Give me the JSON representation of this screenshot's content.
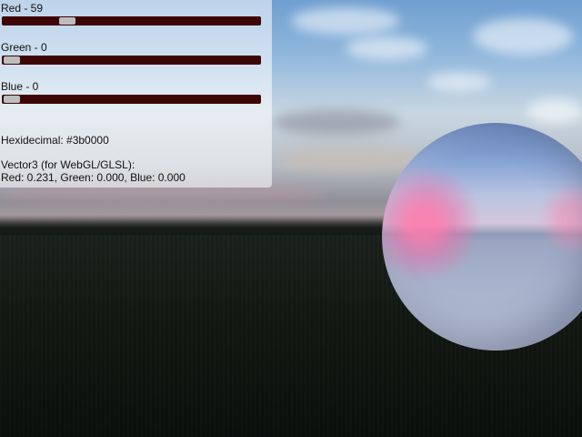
{
  "controls": {
    "red": {
      "label": "Red - 59",
      "value": 59,
      "max": 255
    },
    "green": {
      "label": "Green - 0",
      "value": 0,
      "max": 255
    },
    "blue": {
      "label": "Blue - 0",
      "value": 0,
      "max": 255
    }
  },
  "colors": {
    "track": "#3e0506",
    "thumb": "#bdbdbd"
  },
  "info": {
    "hex_line": "Hexidecimal: #3b0000",
    "vector_heading": "Vector3 (for WebGL/GLSL):",
    "vector_values": "Red: 0.231, Green: 0.000, Blue: 0.000"
  }
}
